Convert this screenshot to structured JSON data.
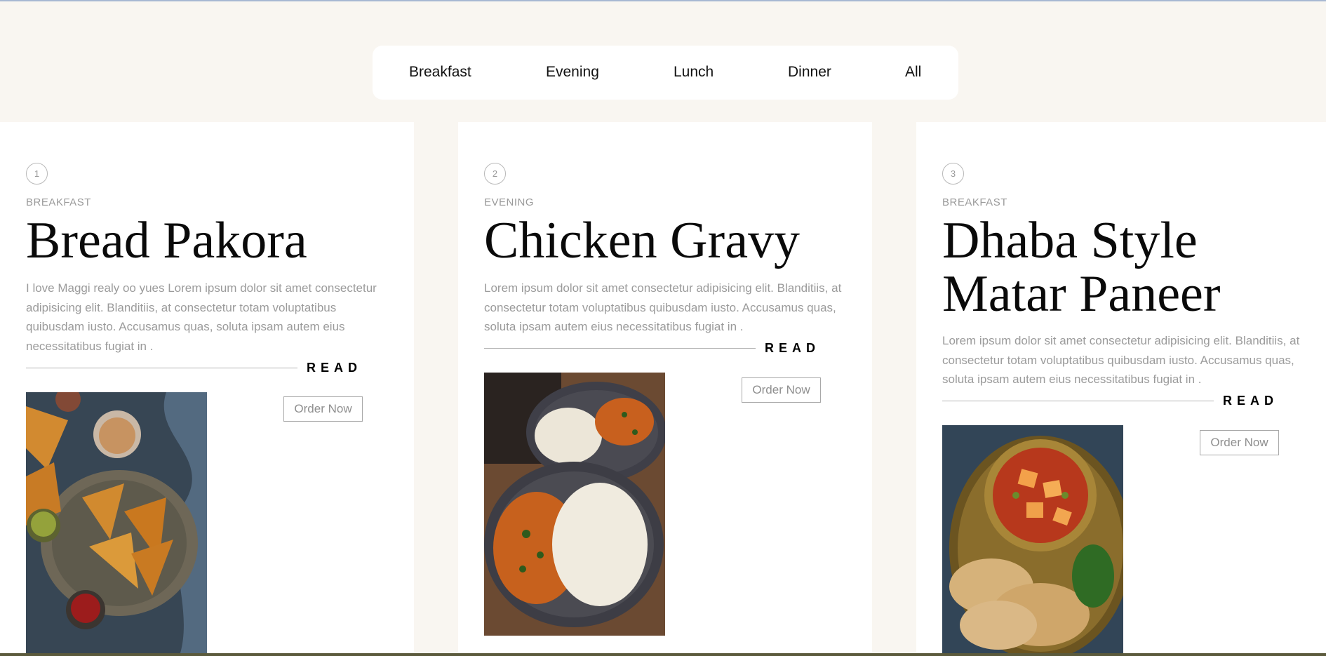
{
  "nav": {
    "items": [
      "Breakfast",
      "Evening",
      "Lunch",
      "Dinner",
      "All"
    ]
  },
  "cards": [
    {
      "number": "1",
      "category": "BREAKFAST",
      "title": "Bread Pakora",
      "description": "I love Maggi realy oo yues Lorem ipsum dolor sit amet consectetur adipisicing elit. Blanditiis, at consectetur totam voluptatibus quibusdam iusto. Accusamus quas, soluta ipsam autem eius necessitatibus fugiat in .",
      "read_label": "READ",
      "order_label": "Order Now",
      "image_alt": "bread-pakora-photo"
    },
    {
      "number": "2",
      "category": "EVENING",
      "title": "Chicken Gravy",
      "description": "Lorem ipsum dolor sit amet consectetur adipisicing elit. Blanditiis, at consectetur totam voluptatibus quibusdam iusto. Accusamus quas, soluta ipsam autem eius necessitatibus fugiat in .",
      "read_label": "READ",
      "order_label": "Order Now",
      "image_alt": "chicken-gravy-rice-photo"
    },
    {
      "number": "3",
      "category": "BREAKFAST",
      "title": "Dhaba Style Matar Paneer",
      "description": "Lorem ipsum dolor sit amet consectetur adipisicing elit. Blanditiis, at consectetur totam voluptatibus quibusdam iusto. Accusamus quas, soluta ipsam autem eius necessitatibus fugiat in .",
      "read_label": "READ",
      "order_label": "Order Now",
      "image_alt": "matar-paneer-photo"
    }
  ],
  "colors": {
    "page_bg": "#f9f6f1",
    "card_bg": "#ffffff",
    "muted_text": "#9b9b9b"
  }
}
